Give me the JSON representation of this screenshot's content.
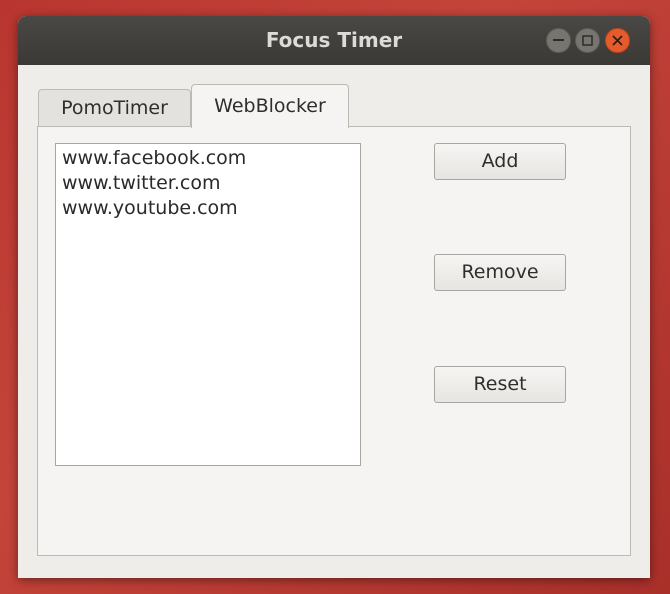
{
  "window": {
    "title": "Focus Timer"
  },
  "tabs": [
    {
      "label": "PomoTimer",
      "active": false
    },
    {
      "label": "WebBlocker",
      "active": true
    }
  ],
  "webblocker": {
    "sites": [
      "www.facebook.com",
      "www.twitter.com",
      "www.youtube.com"
    ],
    "buttons": {
      "add": "Add",
      "remove": "Remove",
      "reset": "Reset"
    }
  },
  "colors": {
    "desktop_background": "#b8362f",
    "titlebar": "#3f3e3b",
    "close_button": "#e45b2c",
    "window_background": "#efede9"
  },
  "icons": {
    "minimize": "minimize-icon",
    "maximize": "maximize-icon",
    "close": "close-icon"
  }
}
